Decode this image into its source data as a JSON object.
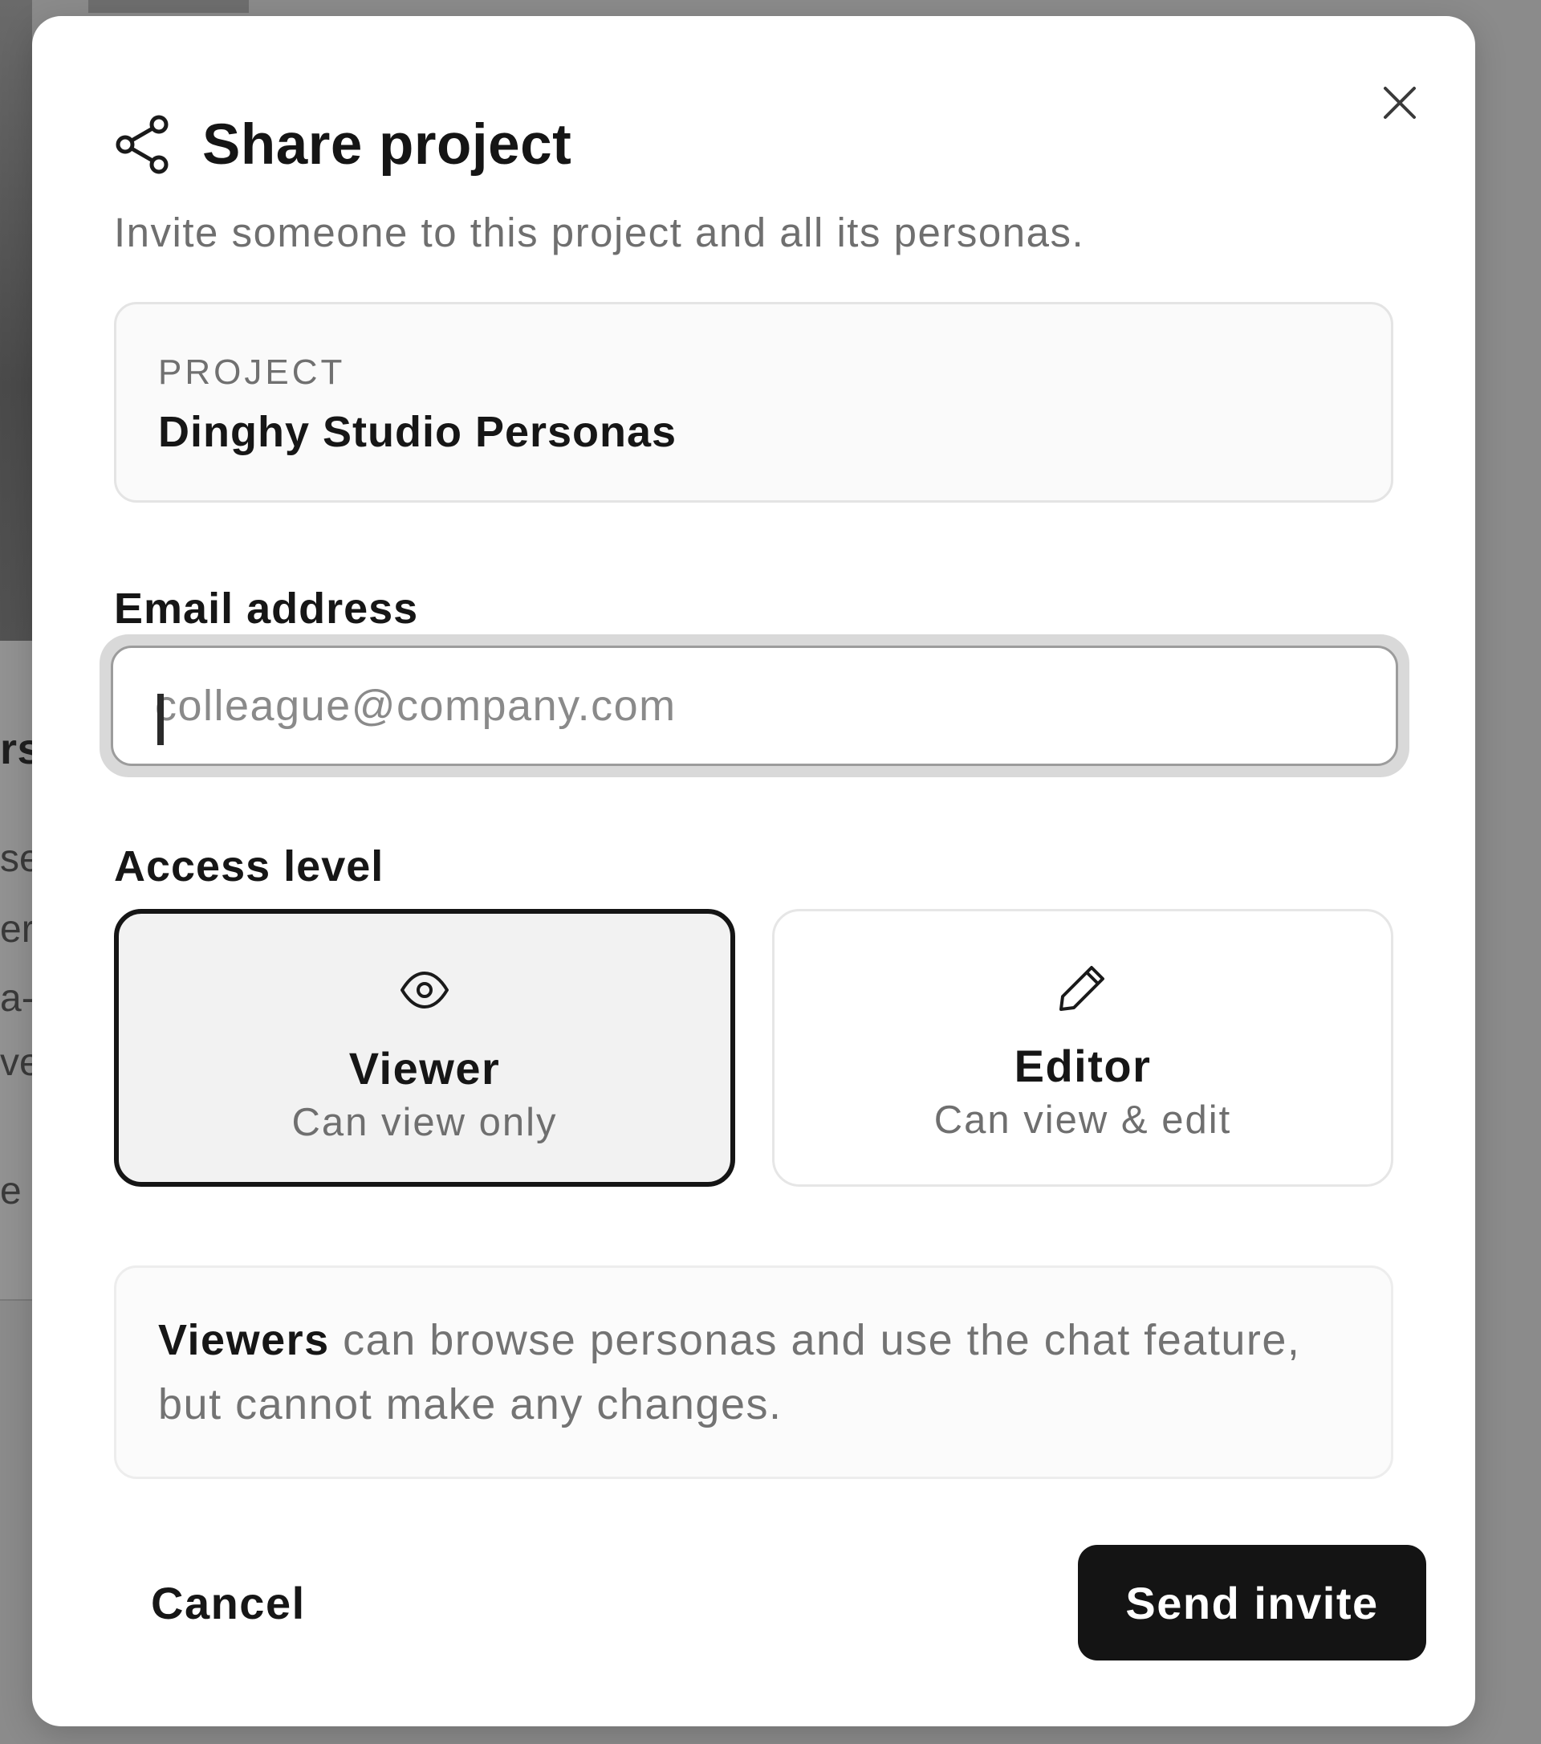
{
  "background": {
    "fragments": [
      {
        "text": "rs",
        "kind": "title"
      },
      {
        "text": "se",
        "kind": "body"
      },
      {
        "text": "er",
        "kind": "body"
      },
      {
        "text": "a-",
        "kind": "body"
      },
      {
        "text": "ve",
        "kind": "body"
      },
      {
        "text": "e",
        "kind": "body"
      }
    ]
  },
  "modal": {
    "title": "Share project",
    "subtitle": "Invite someone to this project and all its personas.",
    "title_icon": "share-icon",
    "close_icon": "close-icon",
    "project": {
      "label": "PROJECT",
      "name": "Dinghy Studio Personas"
    },
    "email": {
      "label": "Email address",
      "placeholder": "colleague@company.com",
      "value": ""
    },
    "access": {
      "label": "Access level",
      "selected": "viewer",
      "options": [
        {
          "id": "viewer",
          "title": "Viewer",
          "description": "Can view only",
          "icon": "eye-icon"
        },
        {
          "id": "editor",
          "title": "Editor",
          "description": "Can view & edit",
          "icon": "pencil-icon"
        }
      ]
    },
    "info": {
      "strong": "Viewers",
      "text": " can browse personas and use the chat feature, but cannot make any changes."
    },
    "actions": {
      "cancel": "Cancel",
      "send": "Send invite"
    }
  },
  "colors": {
    "primary": "#141414",
    "selected_border": "#151515",
    "muted_text": "#6f6f6f",
    "overlay": "#8b8b8b"
  }
}
